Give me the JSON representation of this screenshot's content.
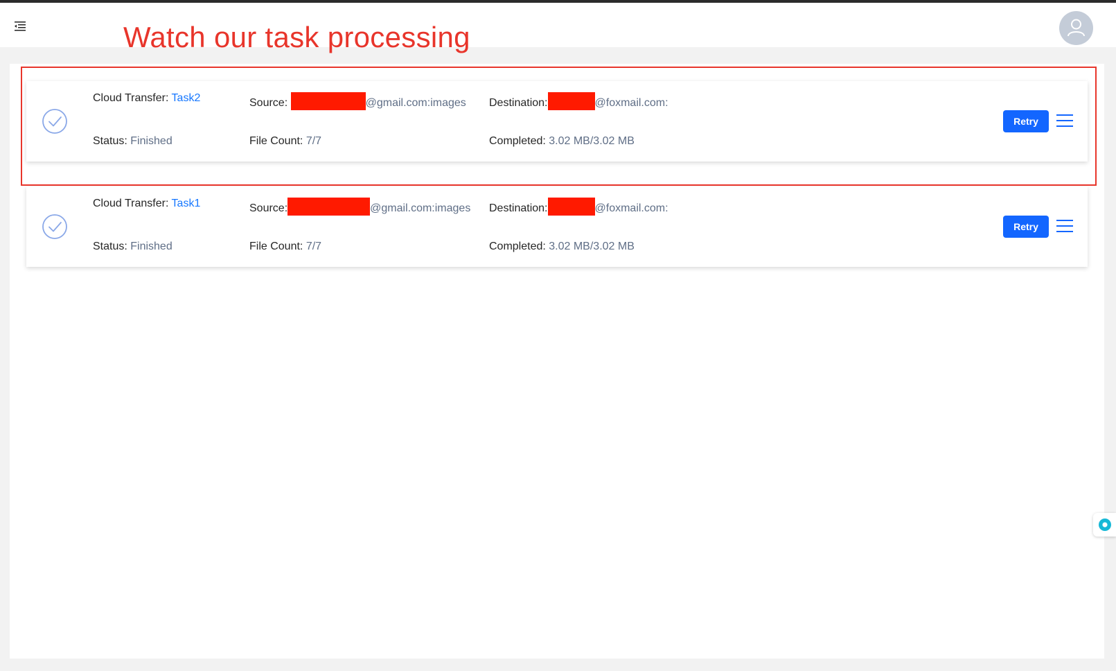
{
  "header": {
    "menu_icon": "indent-menu-icon",
    "annotation_title": "Watch our task processing",
    "avatar_icon": "user-icon"
  },
  "tasks": [
    {
      "prefix_label": "Cloud Transfer: ",
      "name": "Task2",
      "source_label": "Source: ",
      "source_value": "@gmail.com:images",
      "destination_label": "Destination:",
      "destination_value": "@foxmail.com:",
      "status_label": "Status: ",
      "status_value": "Finished",
      "file_count_label": "File Count: ",
      "file_count_value": "7/7",
      "completed_label": "Completed: ",
      "completed_value": "3.02 MB/3.02 MB",
      "retry_label": "Retry",
      "status_icon": "check-circle-icon",
      "more_icon": "hamburger-menu-icon"
    },
    {
      "prefix_label": "Cloud Transfer: ",
      "name": "Task1",
      "source_label": "Source:",
      "source_value": "@gmail.com:images",
      "destination_label": "Destination:",
      "destination_value": "@foxmail.com:",
      "status_label": "Status: ",
      "status_value": "Finished",
      "file_count_label": "File Count: ",
      "file_count_value": "7/7",
      "completed_label": "Completed: ",
      "completed_value": "3.02 MB/3.02 MB",
      "retry_label": "Retry",
      "status_icon": "check-circle-icon",
      "more_icon": "hamburger-menu-icon"
    }
  ],
  "colors": {
    "annotation_red": "#e8352b",
    "redaction_red": "#ff1a00",
    "primary_blue": "#1366ff",
    "link_blue": "#1677ff",
    "value_gray": "#5f6e86"
  },
  "float_widget_icon": "assistant-bubble-icon"
}
